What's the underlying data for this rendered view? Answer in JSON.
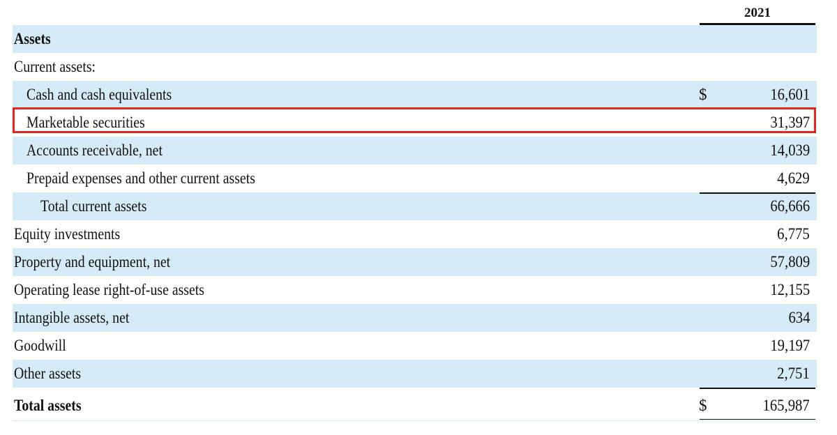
{
  "header": {
    "year": "2021"
  },
  "section_title": "Assets",
  "subsection_title": "Current assets:",
  "currency_symbol": "$",
  "rows": {
    "cash": {
      "label": "Cash and cash equivalents",
      "value": "16,601"
    },
    "marketable": {
      "label": "Marketable securities",
      "value": "31,397"
    },
    "receivable": {
      "label": "Accounts receivable, net",
      "value": "14,039"
    },
    "prepaid": {
      "label": "Prepaid expenses and other current assets",
      "value": "4,629"
    },
    "total_current": {
      "label": "Total current assets",
      "value": "66,666"
    },
    "equity": {
      "label": "Equity investments",
      "value": "6,775"
    },
    "property": {
      "label": "Property and equipment, net",
      "value": "57,809"
    },
    "lease": {
      "label": "Operating lease right-of-use assets",
      "value": "12,155"
    },
    "intangible": {
      "label": "Intangible assets, net",
      "value": "634"
    },
    "goodwill": {
      "label": "Goodwill",
      "value": "19,197"
    },
    "other": {
      "label": "Other assets",
      "value": "2,751"
    },
    "total": {
      "label": "Total assets",
      "value": "165,987"
    }
  },
  "highlight_color": "#e0261f",
  "row_shade_color": "#d6ebf8"
}
